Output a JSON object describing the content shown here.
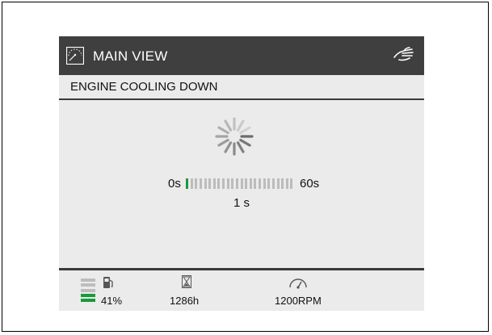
{
  "header": {
    "title": "MAIN VIEW",
    "view_icon": "gauge-view-icon",
    "touch_icon": "hand-touch-icon"
  },
  "status": {
    "message": "ENGINE COOLING DOWN"
  },
  "cooldown": {
    "spinner_icon": "loading-spinner-icon",
    "start_label": "0s",
    "end_label": "60s",
    "current_label": "1 s",
    "progress_fraction": 0.0167,
    "segments_total": 24,
    "segments_filled": 1
  },
  "footer": {
    "fuel": {
      "icon": "fuel-pump-icon",
      "value": "41%",
      "level_bars_total": 5,
      "level_bars_filled": 2
    },
    "hours": {
      "icon": "hourglass-icon",
      "value": "1286h"
    },
    "rpm": {
      "icon": "tachometer-icon",
      "value": "1200RPM"
    }
  },
  "colors": {
    "titlebar": "#3f3f3f",
    "panel": "#ebebeb",
    "accent_green": "#1a9a38",
    "segment_off": "#bcbcbc"
  }
}
